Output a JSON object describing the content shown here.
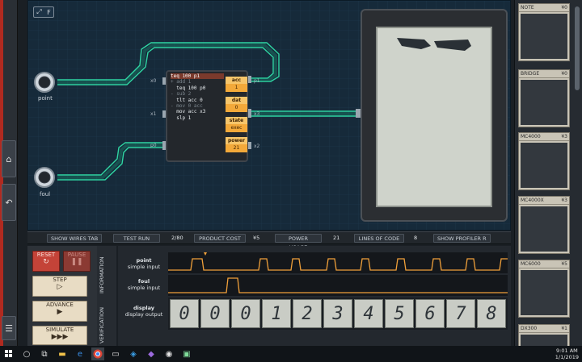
{
  "board": {
    "expand_label": "F",
    "ports": [
      {
        "name": "point"
      },
      {
        "name": "foul"
      }
    ],
    "pins": {
      "x0": "x0",
      "x1": "x1",
      "p0": "p0",
      "p1": "p1",
      "x3": "x3",
      "x2": "x2"
    }
  },
  "chip": {
    "code": [
      {
        "text": "teq 100 p1",
        "style": "hl"
      },
      {
        "text": "+ add 1",
        "style": "dim"
      },
      {
        "text": "  teq 100 p0",
        "style": ""
      },
      {
        "text": "- sub 2",
        "style": "dim"
      },
      {
        "text": "  tlt acc 0",
        "style": ""
      },
      {
        "text": "- mov 0 acc",
        "style": "dim"
      },
      {
        "text": "  mov acc x3",
        "style": ""
      },
      {
        "text": "  slp 1",
        "style": ""
      }
    ],
    "registers": [
      {
        "name": "acc",
        "value": "1"
      },
      {
        "name": "dat",
        "value": "0"
      },
      {
        "name": "state",
        "value": "exec"
      },
      {
        "name": "power",
        "value": "21"
      }
    ]
  },
  "stats": {
    "show_wires": "SHOW WIRES",
    "show_wires_key": "TAB",
    "test_run_label": "TEST RUN",
    "test_run_value": "2/80",
    "product_cost_label": "PRODUCT COST",
    "product_cost_value": "¥5",
    "power_usage_label": "POWER USAGE",
    "power_usage_value": "21",
    "loc_label": "LINES OF CODE",
    "loc_value": "8",
    "profiler": "SHOW PROFILER",
    "profiler_key": "R"
  },
  "controls": {
    "reset": "RESET",
    "pause": "PAUSE",
    "step": "STEP",
    "advance": "ADVANCE",
    "simulate": "SIMULATE"
  },
  "tabs": {
    "information": "INFORMATION",
    "verification": "VERIFICATION"
  },
  "signals": [
    {
      "name": "point",
      "type": "simple input"
    },
    {
      "name": "foul",
      "type": "simple input"
    },
    {
      "name": "display",
      "type": "display output"
    }
  ],
  "display_digits": [
    "0",
    "0",
    "0",
    "1",
    "2",
    "3",
    "4",
    "5",
    "6",
    "7",
    "8"
  ],
  "parts": [
    {
      "name": "NOTE",
      "cost": "¥0"
    },
    {
      "name": "BRIDGE",
      "cost": "¥0"
    },
    {
      "name": "MC4000",
      "cost": "¥3"
    },
    {
      "name": "MC4000X",
      "cost": "¥3"
    },
    {
      "name": "MC6000",
      "cost": "¥5"
    },
    {
      "name": "DX300",
      "cost": "¥1"
    }
  ],
  "taskbar": {
    "time": "9:01 AM",
    "date": "1/1/2019"
  },
  "colors": {
    "wire": "#2fd6a3",
    "accent": "#f0a03a",
    "board": "#162a3a"
  }
}
